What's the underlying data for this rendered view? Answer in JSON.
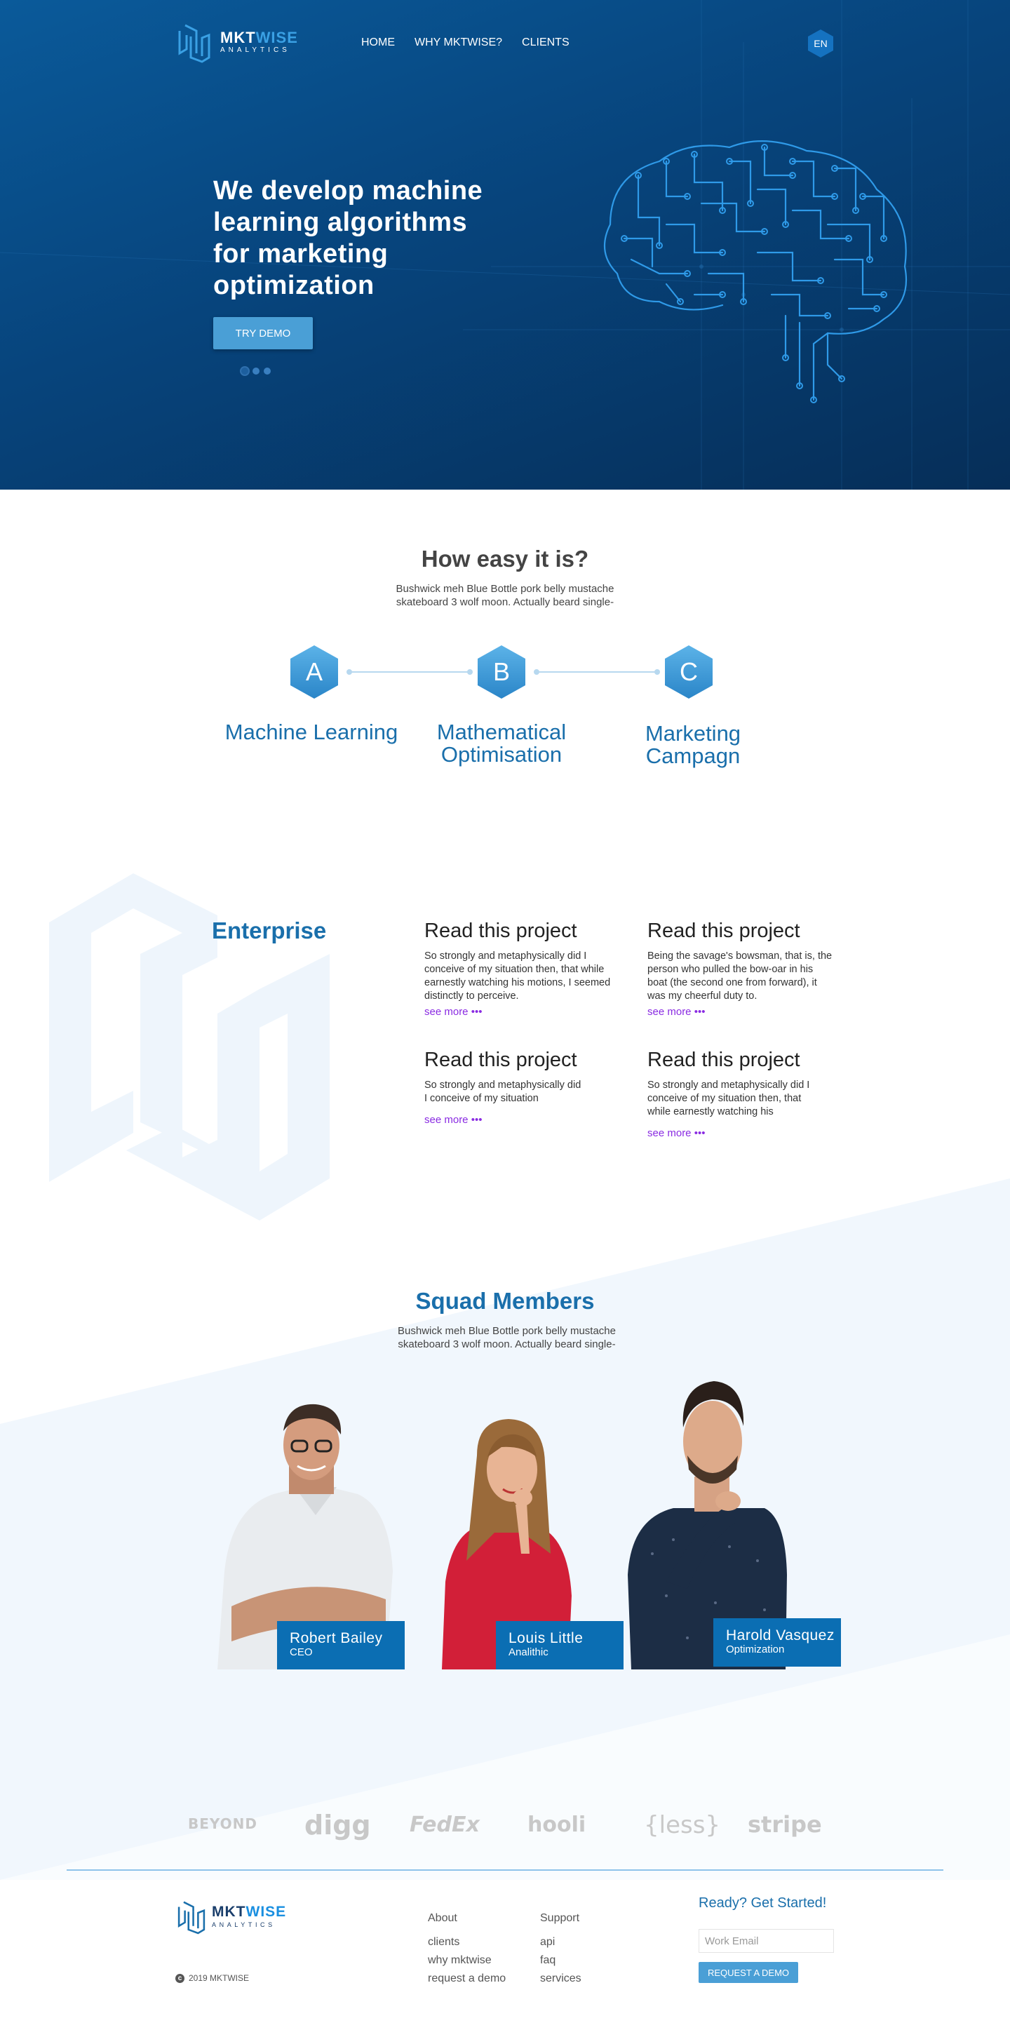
{
  "header": {
    "brand": "MKTWISE",
    "brand_part1": "MKT",
    "brand_part2": "WISE",
    "brand_sub": "ANALYTICS",
    "nav": [
      "HOME",
      "WHY MKTWISE?",
      "CLIENTS"
    ],
    "language": "EN"
  },
  "hero": {
    "title": "We develop machine learning algorithms for marketing optimization",
    "cta": "TRY DEMO",
    "slides": 3,
    "active_slide": 1
  },
  "how": {
    "title": "How easy it is?",
    "description": "Bushwick meh Blue Bottle pork belly mustache skateboard 3 wolf moon. Actually beard single-",
    "steps": [
      {
        "letter": "A",
        "label": "Machine Learning"
      },
      {
        "letter": "B",
        "label": "Mathematical Optimisation"
      },
      {
        "letter": "C",
        "label": "Marketing Campagn"
      }
    ]
  },
  "enterprise": {
    "title": "Enterprise",
    "projects": [
      {
        "title": "Read this project",
        "text": "So strongly and metaphysically did I conceive of my situation then, that while earnestly watching his motions, I seemed distinctly to perceive.",
        "more": "see more •••"
      },
      {
        "title": "Read this project",
        "text": "Being the savage's bowsman, that is, the person who pulled the bow-oar in his boat (the second one from forward), it was my cheerful duty to.",
        "more": "see more •••"
      },
      {
        "title": "Read this project",
        "text": "So strongly and metaphysically did I conceive of my situation",
        "more": "see more •••"
      },
      {
        "title": "Read this project",
        "text": "So strongly and metaphysically did I conceive of my situation then, that while earnestly watching his",
        "more": "see more •••"
      }
    ]
  },
  "squad": {
    "title": "Squad Members",
    "description": "Bushwick meh Blue Bottle pork belly mustache skateboard 3 wolf moon. Actually beard single-",
    "members": [
      {
        "name": "Robert Bailey",
        "role": "CEO"
      },
      {
        "name": "Louis Little",
        "role": "Analithic"
      },
      {
        "name": "Harold Vasquez",
        "role": "Optimization"
      }
    ]
  },
  "clients": [
    "BEYOND",
    "digg",
    "FedEx",
    "hooli",
    "{less}",
    "stripe"
  ],
  "footer": {
    "about": {
      "heading": "About",
      "links": [
        "clients",
        "why mktwise",
        "request a demo"
      ]
    },
    "support": {
      "heading": "Support",
      "links": [
        "api",
        "faq",
        "services"
      ]
    },
    "cta_title": "Ready? Get Started!",
    "email_placeholder": "Work Email",
    "cta_button": "REQUEST A DEMO",
    "copyright": "2019 MKTWISE"
  },
  "colors": {
    "primary": "#1a6fab",
    "hero_dark": "#062e58",
    "button": "#4a9fd6",
    "name_card": "#0b6eb3",
    "see_more": "#8a2be2"
  }
}
